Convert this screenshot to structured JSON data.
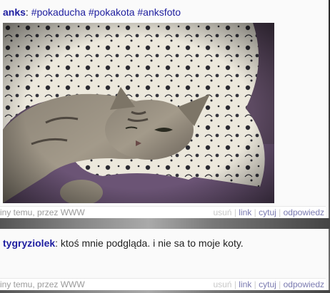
{
  "posts": [
    {
      "author": "anks",
      "separator": ":",
      "text": "#pokaducha #pokakota #anksfoto",
      "meta_left": "iny temu, przez WWW",
      "actions": {
        "delete": "usuń",
        "link": "link",
        "quote": "cytuj",
        "reply": "odpowiedz"
      },
      "image": "cat-under-blanket-photo"
    },
    {
      "author": "tygryziolek",
      "separator": ":",
      "text": "ktoś mnie podgląda. i nie sa to moje koty.",
      "meta_left": "iny temu, przez WWW",
      "actions": {
        "delete": "usuń",
        "link": "link",
        "quote": "cytuj",
        "reply": "odpowiedz"
      }
    }
  ],
  "colors": {
    "author": "#1d1da0",
    "hashtag": "#2020a0",
    "meta": "#9a9a9a",
    "photo_bg": "#5a4a5c"
  }
}
